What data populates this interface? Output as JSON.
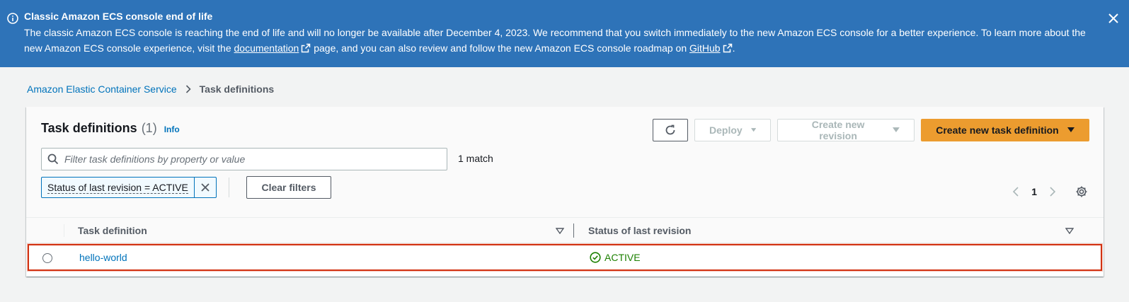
{
  "banner": {
    "title": "Classic Amazon ECS console end of life",
    "text_1": "The classic Amazon ECS console is reaching the end of life and will no longer be available after December 4, 2023. We recommend that you switch immediately to the new Amazon ECS console for a better experience. To learn more about the new Amazon ECS console experience, visit the ",
    "link_docs": "documentation",
    "text_2": " page, and you can also review and follow the new Amazon ECS console roadmap on ",
    "link_github": "GitHub",
    "text_3": "."
  },
  "breadcrumb": {
    "items": [
      {
        "label": "Amazon Elastic Container Service"
      },
      {
        "label": "Task definitions"
      }
    ]
  },
  "panel": {
    "title": "Task definitions",
    "count": "(1)",
    "info_link": "Info"
  },
  "toolbar": {
    "deploy_label": "Deploy",
    "create_revision_label": "Create new revision",
    "create_task_label": "Create new task definition"
  },
  "filter": {
    "placeholder": "Filter task definitions by property or value",
    "value": "",
    "match_text": "1 match",
    "token_label": "Status of last revision = ACTIVE",
    "clear_label": "Clear filters"
  },
  "pagination": {
    "current_page": "1"
  },
  "table": {
    "columns": [
      "Task definition",
      "Status of last revision"
    ],
    "rows": [
      {
        "task_definition": "hello-world",
        "status": "ACTIVE"
      }
    ]
  },
  "colors": {
    "banner_bg": "#2e73b8",
    "link": "#0073bb",
    "primary_button": "#ec9c2f",
    "status_active": "#1d8102",
    "highlight_border": "#d13212"
  }
}
